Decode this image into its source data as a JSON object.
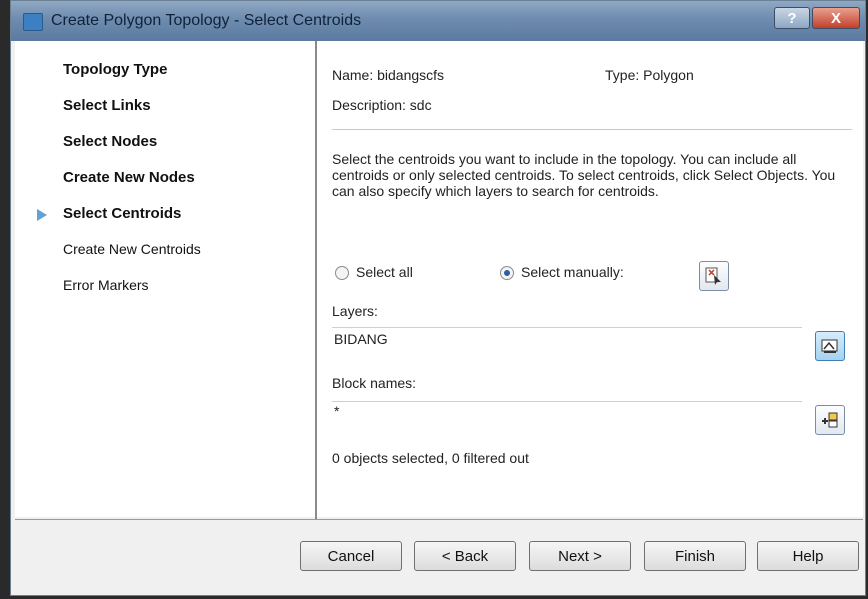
{
  "window": {
    "title": "Create Polygon Topology - Select Centroids",
    "help_label": "?",
    "close_label": "X"
  },
  "steps": [
    {
      "label": "Topology Type"
    },
    {
      "label": "Select Links"
    },
    {
      "label": "Select Nodes"
    },
    {
      "label": "Create New Nodes"
    },
    {
      "label": "Select Centroids"
    },
    {
      "label": "Create New Centroids"
    },
    {
      "label": "Error Markers"
    }
  ],
  "info": {
    "name": "Name: bidangscfs",
    "type": "Type: Polygon",
    "description": "Description: sdc"
  },
  "instructions": "Select the centroids you want to include in the topology. You can include all centroids or only selected centroids. To select centroids, click Select Objects. You can also specify which layers to search for centroids.",
  "selection": {
    "select_all_label": "Select all",
    "select_manually_label": "Select manually:",
    "mode": "manual"
  },
  "layers": {
    "label": "Layers:",
    "value": "BIDANG"
  },
  "block_names": {
    "label": "Block names:",
    "value": "*"
  },
  "status": "0 objects selected, 0 filtered out",
  "buttons": {
    "cancel": "Cancel",
    "back": "< Back",
    "next": "Next >",
    "finish": "Finish",
    "help": "Help"
  }
}
